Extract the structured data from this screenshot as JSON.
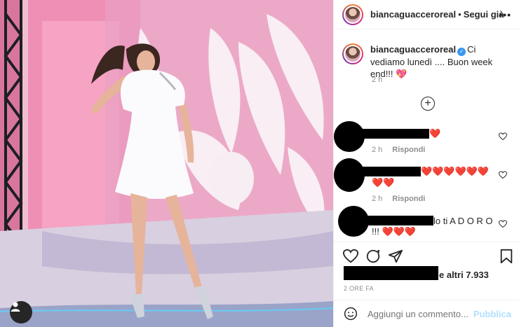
{
  "post": {
    "author": "biancaguacceroreal",
    "follow_label": "Segui già",
    "more_label": "•••",
    "caption_text": "Ci vediamo lunedì .... Buon week end!!! 💖",
    "caption_time": "2 h",
    "likes_suffix": "e altri 7.933",
    "time_ago": "2 ORE FA",
    "add_comment_placeholder": "Aggiungi un commento...",
    "publish_label": "Pubblica"
  },
  "comments": [
    {
      "text_visible": "❤️",
      "time": "2 h",
      "reply_label": "Rispondi"
    },
    {
      "text_visible": "❤️❤️❤️❤️❤️❤️",
      "text_line2": "❤️❤️",
      "time": "2 h",
      "reply_label": "Rispondi"
    },
    {
      "text_visible": "lo ti A D O R O",
      "text_line2": "!!! ❤️❤️❤️"
    }
  ],
  "icons": {
    "like": "heart-icon",
    "comment": "comment-icon",
    "share": "share-icon",
    "save": "bookmark-icon",
    "emoji": "emoji-icon",
    "load_more": "plus-circle-icon",
    "user_tag": "user-tag-icon"
  },
  "colors": {
    "verified": "#3897f0",
    "publish_disabled": "#b2dffc",
    "heart_red": "#ed4956"
  }
}
